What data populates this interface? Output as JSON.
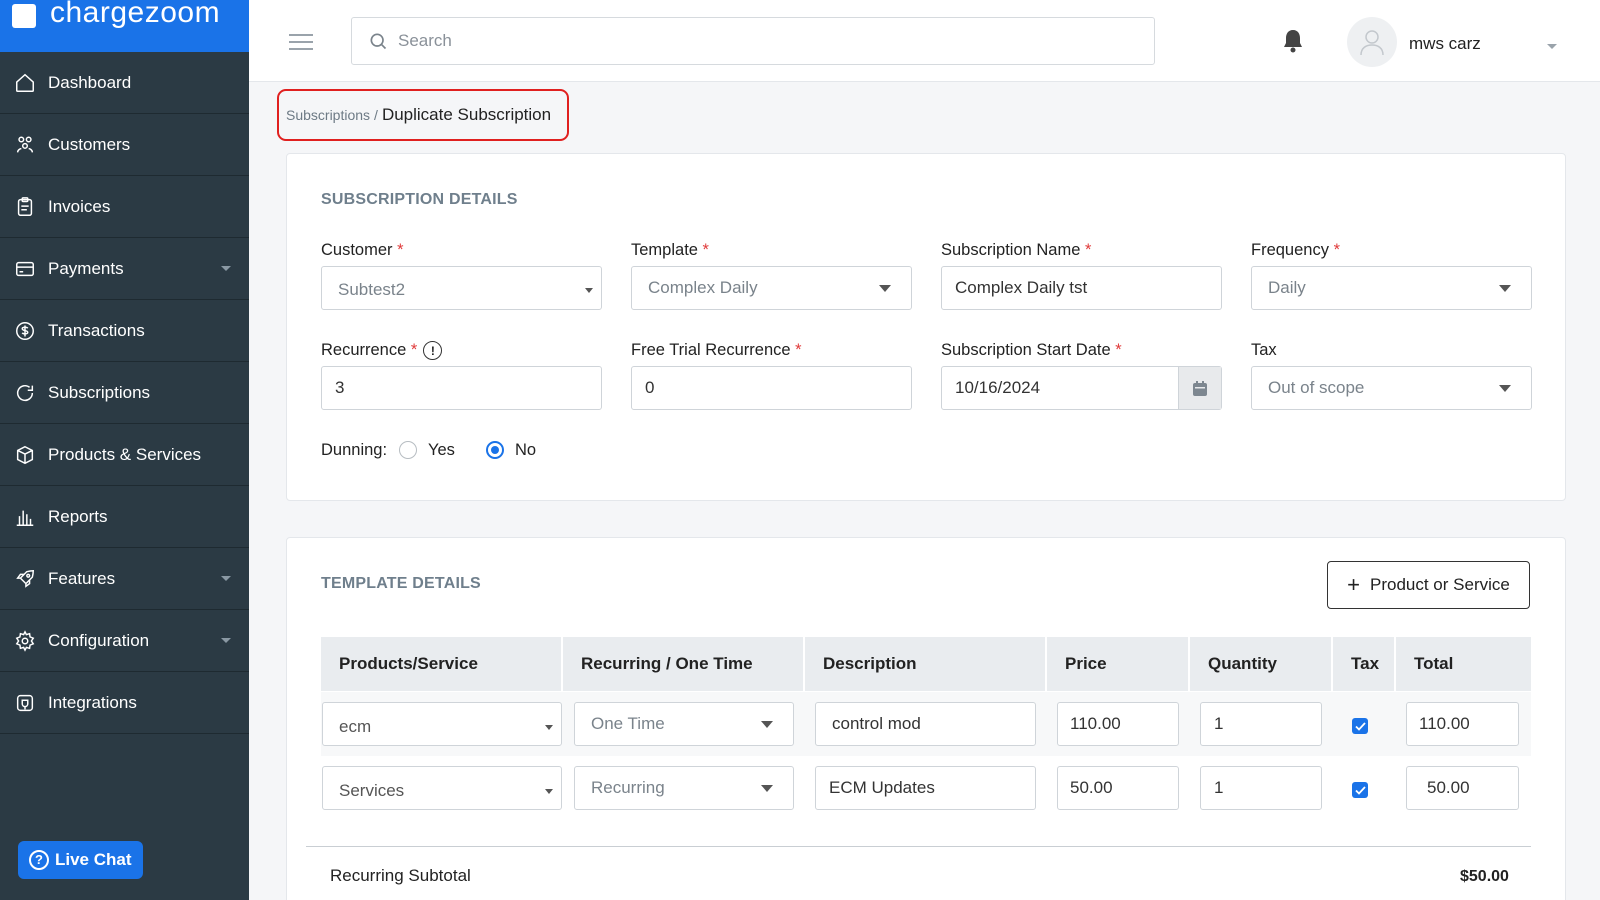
{
  "brand": {
    "name": "chargezoom"
  },
  "sidebar": {
    "items": [
      {
        "label": "Dashboard",
        "icon": "home-icon",
        "has_submenu": false
      },
      {
        "label": "Customers",
        "icon": "users-icon",
        "has_submenu": false
      },
      {
        "label": "Invoices",
        "icon": "clipboard-icon",
        "has_submenu": false
      },
      {
        "label": "Payments",
        "icon": "card-icon",
        "has_submenu": true
      },
      {
        "label": "Transactions",
        "icon": "dollar-icon",
        "has_submenu": false
      },
      {
        "label": "Subscriptions",
        "icon": "refresh-icon",
        "has_submenu": false
      },
      {
        "label": "Products & Services",
        "icon": "box-icon",
        "has_submenu": false
      },
      {
        "label": "Reports",
        "icon": "bar-chart-icon",
        "has_submenu": false
      },
      {
        "label": "Features",
        "icon": "rocket-icon",
        "has_submenu": true
      },
      {
        "label": "Configuration",
        "icon": "gear-icon",
        "has_submenu": true
      },
      {
        "label": "Integrations",
        "icon": "plug-icon",
        "has_submenu": false
      }
    ],
    "live_chat_label": "Live Chat"
  },
  "topbar": {
    "search_placeholder": "Search",
    "username": "mws carz"
  },
  "breadcrumb": {
    "parent": "Subscriptions",
    "separator": "/",
    "current": "Duplicate Subscription"
  },
  "subscription_details": {
    "title": "SUBSCRIPTION DETAILS",
    "customer_label": "Customer",
    "customer_value": "Subtest2",
    "template_label": "Template",
    "template_value": "Complex Daily",
    "subscription_name_label": "Subscription Name",
    "subscription_name_value": "Complex Daily tst",
    "frequency_label": "Frequency",
    "frequency_value": "Daily",
    "recurrence_label": "Recurrence",
    "recurrence_value": "3",
    "free_trial_label": "Free Trial Recurrence",
    "free_trial_value": "0",
    "start_date_label": "Subscription Start Date",
    "start_date_value": "10/16/2024",
    "tax_label": "Tax",
    "tax_value": "Out of scope",
    "dunning_label": "Dunning:",
    "dunning_yes": "Yes",
    "dunning_no": "No",
    "dunning_selected": "No",
    "required_mark": "*"
  },
  "template_details": {
    "title": "TEMPLATE DETAILS",
    "add_button_label": "Product or Service",
    "columns": [
      "Products/Service",
      "Recurring / One Time",
      "Description",
      "Price",
      "Quantity",
      "Tax",
      "Total"
    ],
    "rows": [
      {
        "product": "ecm",
        "type": "One Time",
        "description": "control mod",
        "price": "110.00",
        "quantity": "1",
        "tax": true,
        "total": "110.00"
      },
      {
        "product": "Services",
        "type": "Recurring",
        "description": "ECM Updates",
        "price": "50.00",
        "quantity": "1",
        "tax": true,
        "total": "50.00"
      }
    ],
    "recurring_subtotal_label": "Recurring Subtotal",
    "recurring_subtotal_value": "$50.00"
  },
  "colors": {
    "sidebar_bg": "#2b3a44",
    "brand_bg": "#1a73e8",
    "accent": "#1a73e8",
    "highlight_border": "#e0201f",
    "required": "#e03a3a"
  }
}
